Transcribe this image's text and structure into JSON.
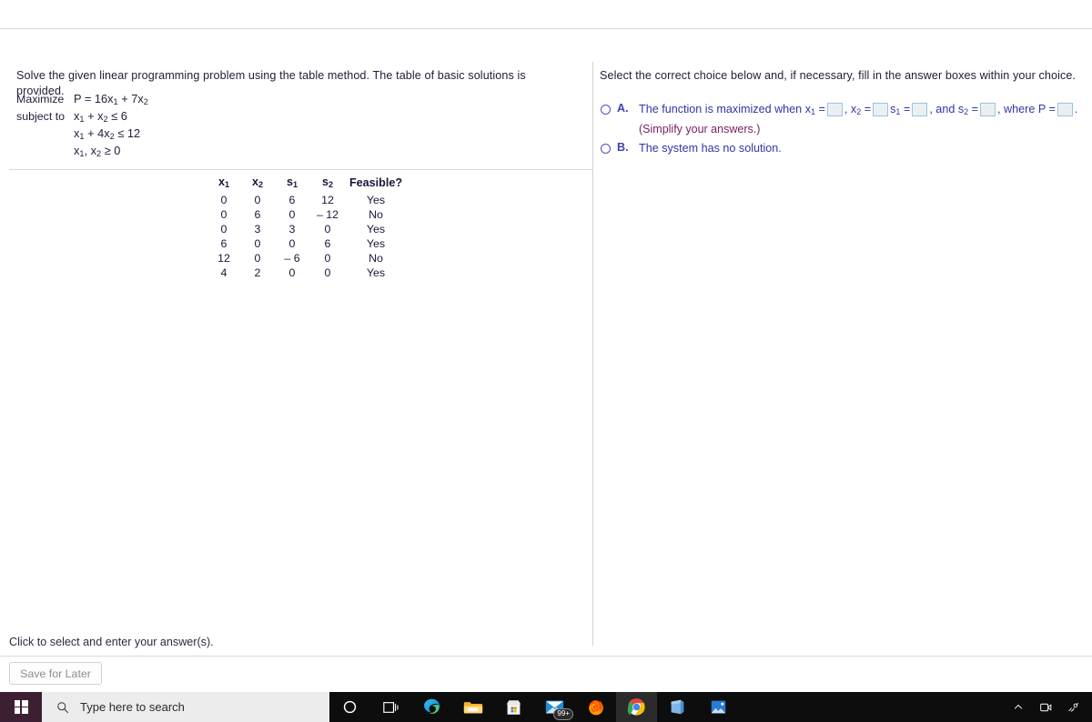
{
  "problem": {
    "instruction": "Solve the given linear programming problem using the table method. The table of basic solutions is provided.",
    "objective_label": "Maximize",
    "objective_expr_html": "P = 16x<sub>1</sub> + 7x<sub>2</sub>",
    "constraint_label": "subject to",
    "constraints_html": [
      "x<sub>1</sub> + x<sub>2</sub> ≤ 6",
      "x<sub>1</sub> + 4x<sub>2</sub> ≤ 12",
      "x<sub>1</sub>, x<sub>2</sub> ≥ 0"
    ]
  },
  "solutions_table": {
    "headers_html": [
      "x<sub>1</sub>",
      "x<sub>2</sub>",
      "s<sub>1</sub>",
      "s<sub>2</sub>",
      "Feasible?"
    ],
    "rows": [
      [
        "0",
        "0",
        "6",
        "12",
        "Yes"
      ],
      [
        "0",
        "6",
        "0",
        "– 12",
        "No"
      ],
      [
        "0",
        "3",
        "3",
        "0",
        "Yes"
      ],
      [
        "6",
        "0",
        "0",
        "6",
        "Yes"
      ],
      [
        "12",
        "0",
        "– 6",
        "0",
        "No"
      ],
      [
        "4",
        "2",
        "0",
        "0",
        "Yes"
      ]
    ]
  },
  "answer_panel": {
    "prompt": "Select the correct choice below and, if necessary, fill in the answer boxes within your choice.",
    "choices": [
      {
        "letter": "A.",
        "segments_html": [
          "The function is maximized when x<sub>1</sub> =",
          ", x<sub>2</sub> =",
          "s<sub>1</sub> =",
          ", and s<sub>2</sub> =",
          ", where P =",
          "."
        ],
        "note": "(Simplify your answers.)"
      },
      {
        "letter": "B.",
        "text": "The system has no solution."
      }
    ]
  },
  "footer": {
    "hint": "Click to select and enter your answer(s).",
    "save_label": "Save for Later"
  },
  "taskbar": {
    "search_placeholder": "Type here to search",
    "mail_badge": "99+",
    "items": [
      "cortana-icon",
      "task-view-icon",
      "edge-icon",
      "file-explorer-icon",
      "microsoft-store-icon",
      "mail-icon",
      "firefox-icon",
      "chrome-icon",
      "onenote-icon",
      "photos-icon"
    ],
    "tray": [
      "show-hidden-icons-chevron",
      "webcam-icon",
      "network-icon"
    ]
  },
  "colors": {
    "choice_blue": "#3333a8",
    "simplify_magenta": "#7a2060",
    "start_plum": "#3d1f33",
    "taskbar_black": "#0d0d0d"
  }
}
